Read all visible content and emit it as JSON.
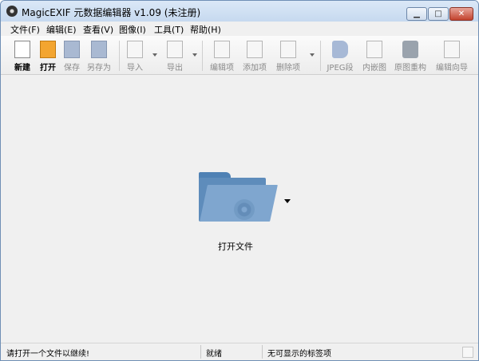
{
  "window": {
    "title": "MagicEXIF 元数据编辑器 v1.09 (未注册)"
  },
  "menu": {
    "items": [
      "文件(F)",
      "编辑(E)",
      "查看(V)",
      "图像(I)",
      "工具(T)",
      "帮助(H)"
    ]
  },
  "toolbar": {
    "new": "新建",
    "open": "打开",
    "save": "保存",
    "save_as": "另存为",
    "import": "导入",
    "export": "导出",
    "edit_item": "编辑项",
    "add_item": "添加项",
    "delete_item": "删除项",
    "jpeg_segment": "JPEG段",
    "embedded_image": "内嵌图",
    "rebuild_original": "原图重构",
    "edit_wizard": "编辑向导"
  },
  "main": {
    "open_file_label": "打开文件"
  },
  "status": {
    "hint": "请打开一个文件以继续!",
    "state": "就绪",
    "tags": "无可显示的标签项"
  },
  "icons": {
    "app": "camera-lens-icon",
    "new": "new-document-icon",
    "open": "folder-open-icon",
    "save": "floppy-disk-icon",
    "save_as": "floppy-edit-icon",
    "import": "import-icon",
    "export": "export-icon",
    "edit_item": "edit-item-icon",
    "add_item": "add-item-icon",
    "delete_item": "delete-item-icon",
    "jpeg_segment": "tag-icon",
    "embedded_image": "embedded-image-icon",
    "rebuild_original": "camera-icon",
    "edit_wizard": "wizard-icon"
  },
  "colors": {
    "folder": "#5e8cbb",
    "close_button": "#c2422d",
    "disabled_text": "#8a8a8a"
  }
}
